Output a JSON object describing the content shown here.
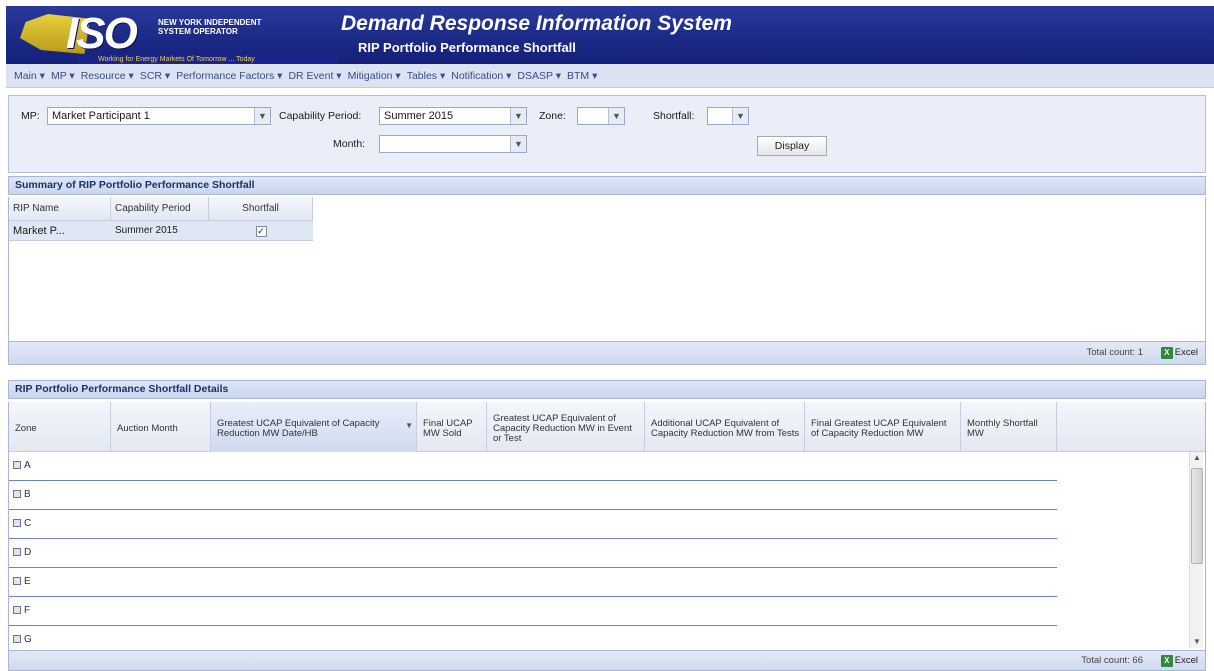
{
  "header": {
    "logo_text": "ISO",
    "org_name": "NEW YORK INDEPENDENT SYSTEM OPERATOR",
    "tagline": "Working for Energy Markets Of Tomorrow ... Today",
    "app_title": "Demand Response Information System",
    "page_title": "RIP Portfolio Performance Shortfall"
  },
  "menu": [
    "Main ▾",
    "MP ▾",
    "Resource ▾",
    "SCR ▾",
    "Performance Factors ▾",
    "DR Event ▾",
    "Mitigation ▾",
    "Tables ▾",
    "Notification ▾",
    "DSASP ▾",
    "BTM ▾"
  ],
  "filters": {
    "mp_label": "MP:",
    "mp_value": "Market Participant 1",
    "capability_period_label": "Capability Period:",
    "capability_period_value": "Summer 2015",
    "zone_label": "Zone:",
    "zone_value": "",
    "shortfall_label": "Shortfall:",
    "shortfall_value": "",
    "month_label": "Month:",
    "month_value": "",
    "display_button": "Display"
  },
  "summary": {
    "title": "Summary of RIP Portfolio Performance Shortfall",
    "columns": [
      "RIP Name",
      "Capability Period",
      "Shortfall"
    ],
    "rows": [
      {
        "rip_name": "Market P...",
        "capability_period": "Summer 2015",
        "shortfall_checked": true
      }
    ],
    "total_count": "Total count: 1",
    "excel": "Excel"
  },
  "details": {
    "title": "RIP Portfolio Performance Shortfall Details",
    "columns": [
      "Zone",
      "Auction Month",
      "Greatest UCAP Equivalent of Capacity Reduction MW Date/HB",
      "Final UCAP MW Sold",
      "Greatest UCAP Equivalent of Capacity Reduction MW in Event or Test",
      "Additional UCAP Equivalent of Capacity Reduction MW from Tests",
      "Final Greatest UCAP Equivalent of Capacity Reduction MW",
      "Monthly Shortfall MW"
    ],
    "groups": [
      "A",
      "B",
      "C",
      "D",
      "E",
      "F",
      "G"
    ],
    "total_count": "Total count: 66",
    "excel": "Excel"
  },
  "colors": {
    "banner": "#1c2a86",
    "menu_bg": "#dbe3f3",
    "section_header": "#c9d5ee",
    "selected_row": "#dfe7f5"
  }
}
